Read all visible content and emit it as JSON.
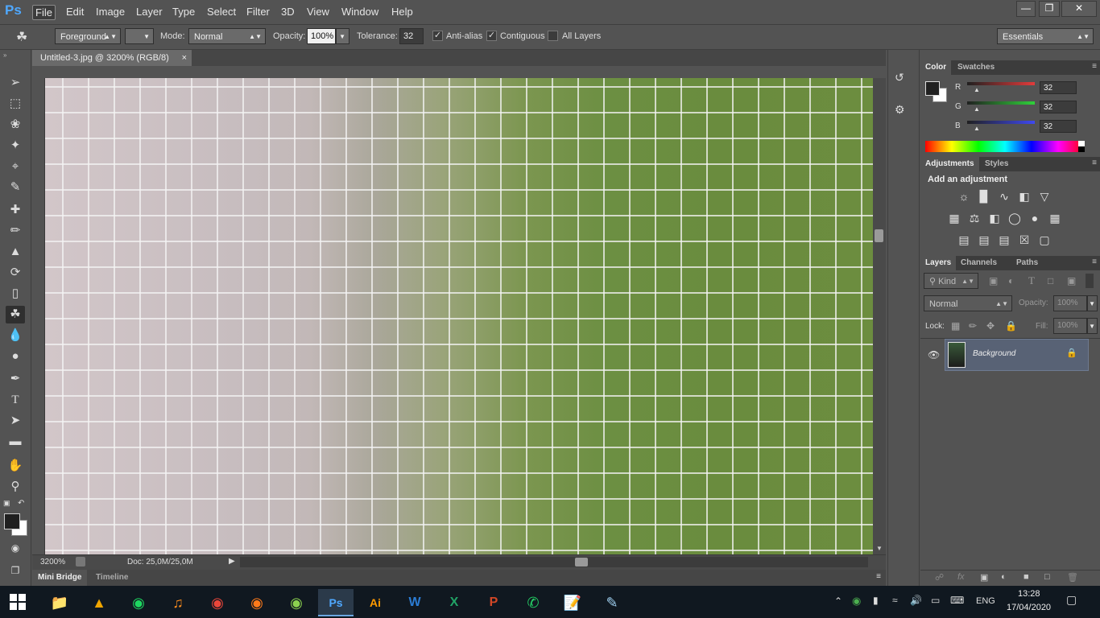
{
  "app": {
    "logo": "Ps"
  },
  "menu": [
    "File",
    "Edit",
    "Image",
    "Layer",
    "Type",
    "Select",
    "Filter",
    "3D",
    "View",
    "Window",
    "Help"
  ],
  "window_controls": [
    "minimize",
    "restore",
    "close"
  ],
  "options": {
    "fill_source": "Foreground",
    "mode_label": "Mode:",
    "mode_value": "Normal",
    "opacity_label": "Opacity:",
    "opacity_value": "100%",
    "tolerance_label": "Tolerance:",
    "tolerance_value": "32",
    "anti_alias": {
      "label": "Anti-alias",
      "checked": true
    },
    "contiguous": {
      "label": "Contiguous",
      "checked": true
    },
    "all_layers": {
      "label": "All Layers",
      "checked": false
    },
    "workspace": "Essentials"
  },
  "document": {
    "tab_title": "Untitled-3.jpg @ 3200% (RGB/8)",
    "zoom": "3200%",
    "doc_size": "Doc: 25,0M/25,0M"
  },
  "bottom_tabs": [
    "Mini Bridge",
    "Timeline"
  ],
  "color_panel": {
    "tabs": [
      "Color",
      "Swatches"
    ],
    "channels": [
      {
        "name": "R",
        "value": "32",
        "color": "#e23b3b"
      },
      {
        "name": "G",
        "value": "32",
        "color": "#2fd13a"
      },
      {
        "name": "B",
        "value": "32",
        "color": "#3f49f0"
      }
    ]
  },
  "adjustments_panel": {
    "tabs": [
      "Adjustments",
      "Styles"
    ],
    "heading": "Add an adjustment",
    "rows": [
      [
        "brightness-icon",
        "levels-icon",
        "curves-icon",
        "exposure-icon",
        "vibrance-icon"
      ],
      [
        "hue-saturation-icon",
        "color-balance-icon",
        "black-white-icon",
        "photo-filter-icon",
        "channel-mixer-icon",
        "color-lookup-icon"
      ],
      [
        "invert-icon",
        "posterize-icon",
        "threshold-icon",
        "selective-color-icon",
        "gradient-map-icon"
      ]
    ]
  },
  "layers_panel": {
    "tabs": [
      "Layers",
      "Channels",
      "Paths"
    ],
    "filter_kind": "Kind",
    "blend_mode": "Normal",
    "opacity_label": "Opacity:",
    "opacity_value": "100%",
    "lock_label": "Lock:",
    "fill_label": "Fill:",
    "fill_value": "100%",
    "layers": [
      {
        "name": "Background",
        "visible": true,
        "locked": true
      }
    ]
  },
  "taskbar": {
    "apps": [
      "file-explorer",
      "autodesk",
      "spotify",
      "fl-studio",
      "chrome",
      "firefox",
      "green-app",
      "photoshop",
      "illustrator",
      "word",
      "excel",
      "powerpoint",
      "whatsapp",
      "notepad",
      "drawing-app"
    ],
    "active_app": "photoshop",
    "language": "ENG",
    "time": "13:28",
    "date": "17/04/2020"
  }
}
